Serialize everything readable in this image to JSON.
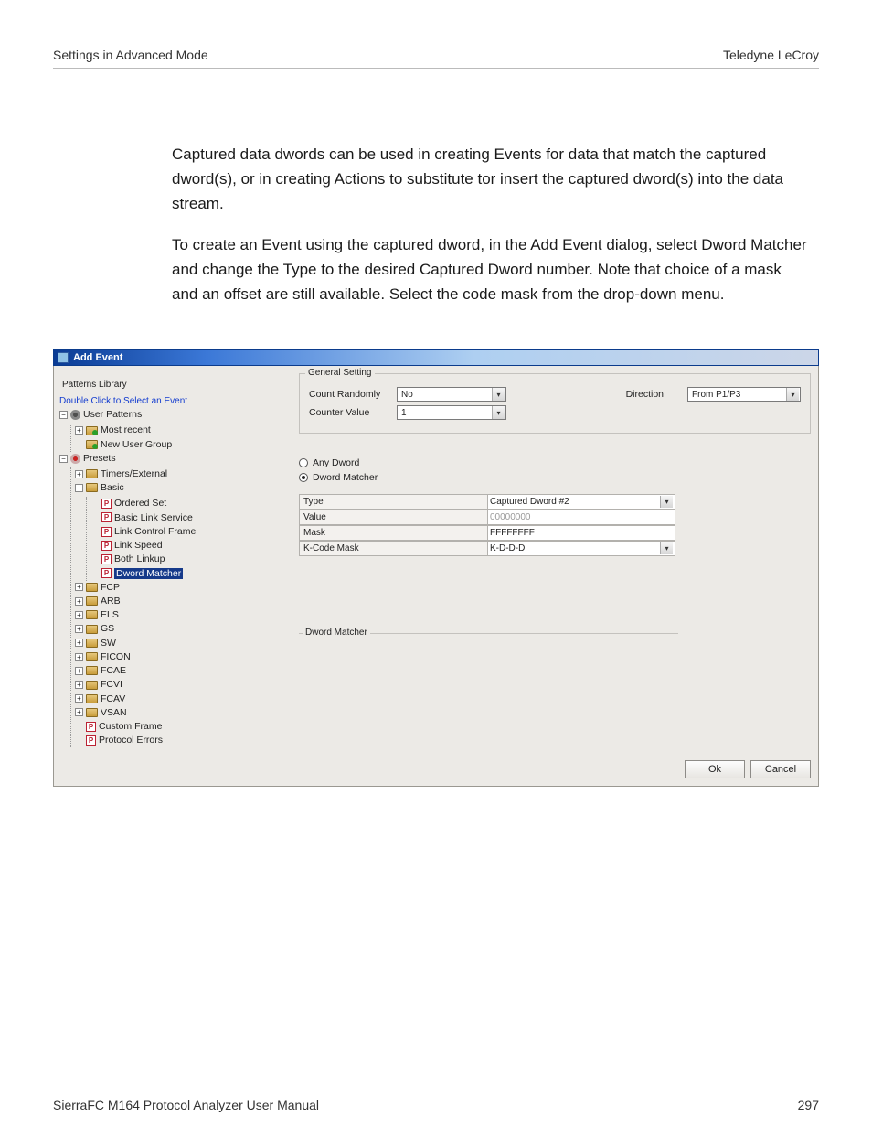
{
  "header": {
    "left": "Settings in Advanced Mode",
    "right": "Teledyne LeCroy"
  },
  "paragraphs": [
    "Captured data dwords can be used in creating Events for data that match the captured dword(s), or in creating Actions to substitute tor insert the captured dword(s) into the data stream.",
    "To create an Event using the captured dword, in the Add Event dialog, select Dword Matcher and change the Type to the desired Captured Dword number. Note that choice of a mask and an offset are still available. Select the code mask from the drop-down menu."
  ],
  "dialog": {
    "title": "Add Event",
    "patterns": {
      "legend": "Patterns Library",
      "hint": "Double Click to Select an Event",
      "tree": {
        "user_patterns": "User Patterns",
        "most_recent": "Most recent",
        "new_user_group": "New User Group",
        "presets": "Presets",
        "timers_external": "Timers/External",
        "basic": "Basic",
        "ordered_set": "Ordered Set",
        "basic_link_service": "Basic Link Service",
        "link_control_frame": "Link Control Frame",
        "link_speed": "Link Speed",
        "both_linkup": "Both Linkup",
        "dword_matcher": "Dword Matcher",
        "fcp": "FCP",
        "arb": "ARB",
        "els": "ELS",
        "gs": "GS",
        "sw": "SW",
        "ficon": "FICON",
        "fcae": "FCAE",
        "fcvi": "FCVI",
        "fcav": "FCAV",
        "vsan": "VSAN",
        "custom_frame": "Custom Frame",
        "protocol_errors": "Protocol Errors"
      }
    },
    "general": {
      "legend": "General Setting",
      "count_randomly_label": "Count Randomly",
      "count_randomly_value": "No",
      "counter_value_label": "Counter Value",
      "counter_value_value": "1",
      "direction_label": "Direction",
      "direction_value": "From P1/P3"
    },
    "radios": {
      "any_dword": "Any Dword",
      "dword_matcher": "Dword Matcher"
    },
    "grid": {
      "type_label": "Type",
      "type_value": "Captured Dword #2",
      "value_label": "Value",
      "value_value": "00000000",
      "mask_label": "Mask",
      "mask_value": "FFFFFFFF",
      "kcode_label": "K-Code Mask",
      "kcode_value": "K-D-D-D"
    },
    "dword_group_legend": "Dword Matcher",
    "ok": "Ok",
    "cancel": "Cancel"
  },
  "footer": {
    "left": "SierraFC M164 Protocol Analyzer User Manual",
    "right": "297"
  }
}
